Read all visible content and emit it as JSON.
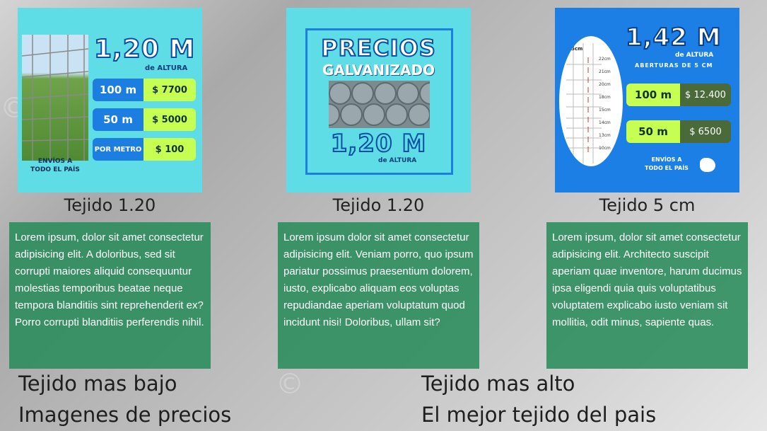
{
  "cards": [
    {
      "image": {
        "headline": "1,20 M",
        "sub": "de ALTURA",
        "rows": [
          {
            "qty": "100 m",
            "price": "$ 7700"
          },
          {
            "qty": "50 m",
            "price": "$ 5000"
          },
          {
            "qty": "POR METRO",
            "price": "$ 100"
          }
        ],
        "shipping_1": "ENVÍOS A",
        "shipping_2": "TODO EL PAÍS"
      },
      "caption": "Tejido 1.20",
      "text": "Lorem ipsum, dolor sit amet consectetur adipisicing elit. A doloribus, sed sit corrupti maiores aliquid consequuntur molestias temporibus beatae neque tempora blanditiis sint reprehenderit ex? Porro corrupti blanditiis perferendis nihil."
    },
    {
      "image": {
        "line1": "PRECIOS",
        "line2": "GALVANIZADO",
        "headline": "1,20 M",
        "sub": "de ALTURA"
      },
      "caption": "Tejido 1.20",
      "text": "Lorem ipsum dolor sit amet consectetur adipisicing elit. Veniam porro, quo ipsum pariatur possimus praesentium dolorem, iusto, explicabo aliquam eos voluptas repudiandae aperiam voluptatum quod incidunt nisi! Doloribus, ullam sit?"
    },
    {
      "image": {
        "headline": "1,42 M",
        "sub": "de ALTURA",
        "sub2": "ABERTURAS DE 5 CM",
        "rows": [
          {
            "qty": "100 m",
            "price": "$ 12.400"
          },
          {
            "qty": "50 m",
            "price": "$ 6500"
          }
        ],
        "shipping_1": "ENVÍOS A",
        "shipping_2": "TODO EL PAÍS",
        "diagram_top": "5cm",
        "diagram_labels": [
          "22cm",
          "21cm",
          "20cm",
          "18cm",
          "15cm",
          "14cm",
          "13cm",
          "10cm"
        ]
      },
      "caption": "Tejido 5 cm",
      "text": "Lorem ipsum, dolor sit amet consectetur adipisicing elit. Architecto suscipit aperiam quae inventore, harum ducimus ipsa eligendi quia quis voluptatibus voluptatem explicabo iusto veniam sit mollitia, odit minus, sapiente quas."
    }
  ],
  "footer": {
    "left_1": "Tejido mas bajo",
    "left_2": "Imagenes de precios",
    "right_1": "Tejido mas alto",
    "right_2": "El mejor tejido del pais"
  },
  "colors": {
    "card_bg_cyan": "#5fdde6",
    "card_bg_blue": "#1c7fe6",
    "desc_bg": "#288c5a",
    "price_tag": "#c6ff52"
  }
}
